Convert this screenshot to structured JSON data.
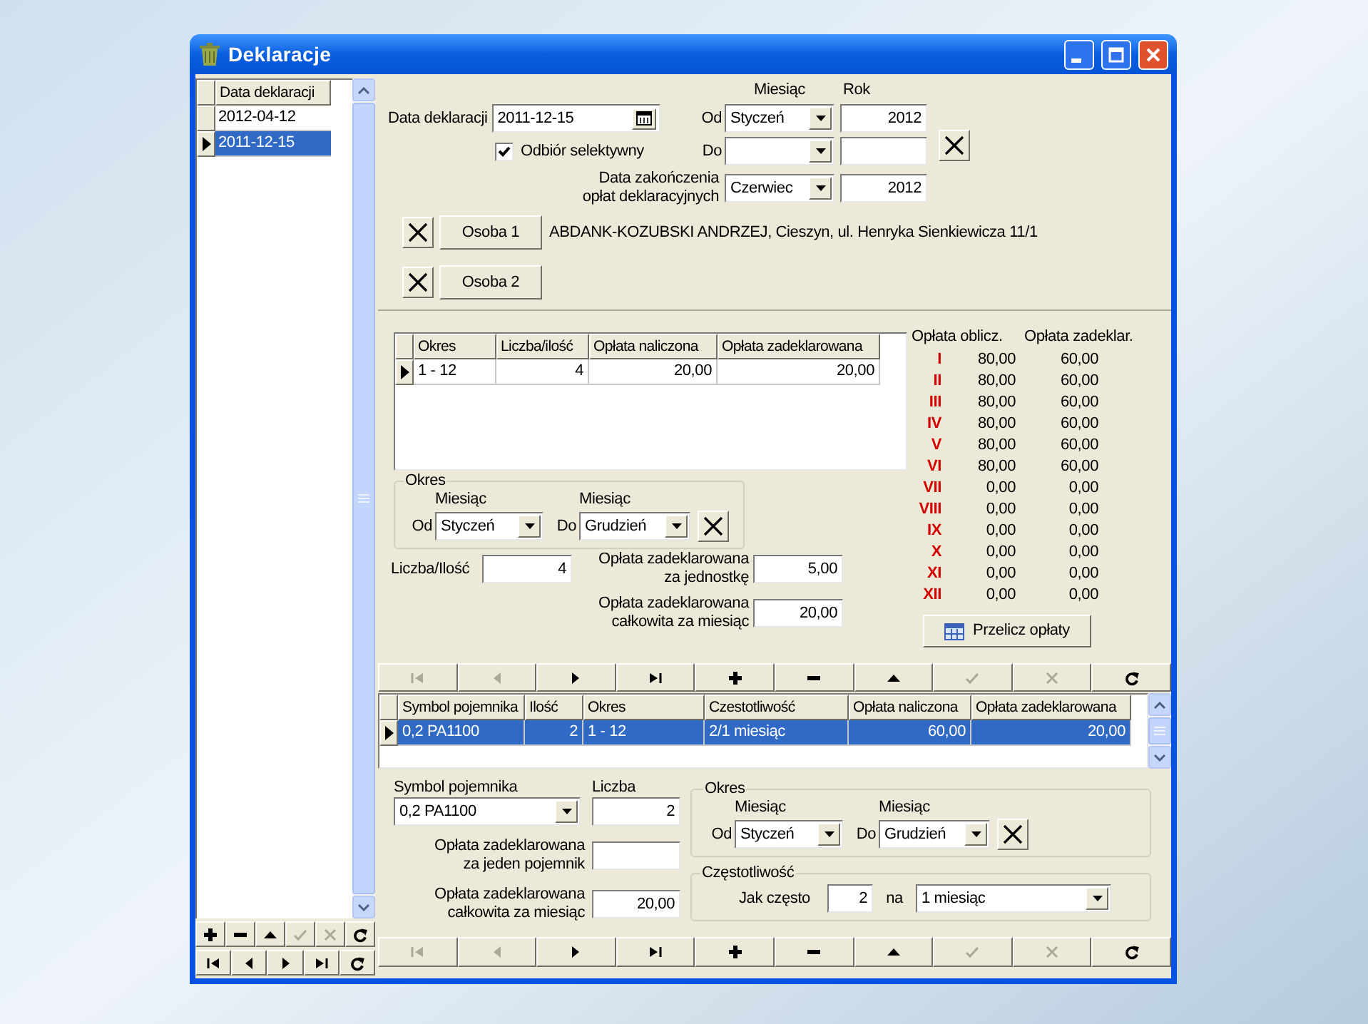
{
  "window": {
    "title": "Deklaracje"
  },
  "declarations": {
    "column": "Data deklaracji",
    "rows": [
      {
        "date": "2012-04-12",
        "current": false,
        "selected": false
      },
      {
        "date": "2011-12-15",
        "current": true,
        "selected": true
      }
    ]
  },
  "list_toolbar": {
    "rows": [
      [
        {
          "kind": "add",
          "disabled": false
        },
        {
          "kind": "remove",
          "disabled": false
        },
        {
          "kind": "up",
          "disabled": false
        },
        {
          "kind": "confirm",
          "disabled": true
        },
        {
          "kind": "cancel",
          "disabled": true
        },
        {
          "kind": "refresh",
          "disabled": false
        }
      ],
      [
        {
          "kind": "first",
          "disabled": false
        },
        {
          "kind": "prev",
          "disabled": false
        },
        {
          "kind": "next",
          "disabled": false
        },
        {
          "kind": "last",
          "disabled": false
        },
        {
          "kind": "refresh",
          "disabled": false
        }
      ]
    ]
  },
  "declaration": {
    "date_label": "Data deklaracji",
    "date": "2011-12-15",
    "month_header": "Miesiąc",
    "year_header": "Rok",
    "from_label": "Od",
    "from_month": "Styczeń",
    "from_year": "2012",
    "selective": {
      "label": "Odbiór selektywny",
      "checked": true
    },
    "to_label": "Do",
    "end_label": "Data zakończenia\nopłat deklaracyjnych",
    "end_month": "Czerwiec",
    "end_year": "2012"
  },
  "persons": [
    {
      "button": "Osoba 1",
      "details": "ABDANK-KOZUBSKI ANDRZEJ, Cieszyn, ul. Henryka Sienkiewicza 11/1"
    },
    {
      "button": "Osoba 2"
    }
  ],
  "periods_table": {
    "columns": [
      "Okres",
      "Liczba/ilość",
      "Opłata naliczona",
      "Opłata zadeklarowana"
    ],
    "rows": [
      {
        "cells": [
          "1 - 12",
          "4",
          "20,00",
          "20,00"
        ],
        "current": true,
        "selected": false
      }
    ]
  },
  "period": {
    "title": "Okres",
    "from_header": "Miesiąc",
    "from_label": "Od",
    "from": "Styczeń",
    "to_header": "Miesiąc",
    "to_label": "Do",
    "to": "Grudzień"
  },
  "quantity": {
    "label": "Liczba/Ilość",
    "value": "4"
  },
  "unit_fee": {
    "label": "Opłata zadeklarowana\nza jednostkę",
    "value": "5,00"
  },
  "monthly_fee": {
    "label": "Opłata zadeklarowana\ncałkowita za miesiąc",
    "value": "20,00"
  },
  "summary": {
    "columns": [
      "Opłata oblicz.",
      "Opłata zadeklar."
    ],
    "rows": [
      {
        "month": "I",
        "calculated": "80,00",
        "declared": "60,00"
      },
      {
        "month": "II",
        "calculated": "80,00",
        "declared": "60,00"
      },
      {
        "month": "III",
        "calculated": "80,00",
        "declared": "60,00"
      },
      {
        "month": "IV",
        "calculated": "80,00",
        "declared": "60,00"
      },
      {
        "month": "V",
        "calculated": "80,00",
        "declared": "60,00"
      },
      {
        "month": "VI",
        "calculated": "80,00",
        "declared": "60,00"
      },
      {
        "month": "VII",
        "calculated": "0,00",
        "declared": "0,00"
      },
      {
        "month": "VIII",
        "calculated": "0,00",
        "declared": "0,00"
      },
      {
        "month": "IX",
        "calculated": "0,00",
        "declared": "0,00"
      },
      {
        "month": "X",
        "calculated": "0,00",
        "declared": "0,00"
      },
      {
        "month": "XI",
        "calculated": "0,00",
        "declared": "0,00"
      },
      {
        "month": "XII",
        "calculated": "0,00",
        "declared": "0,00"
      }
    ]
  },
  "recalculate_button": "Przelicz opłaty",
  "periods_toolbar": [
    {
      "kind": "first",
      "disabled": true
    },
    {
      "kind": "prev",
      "disabled": true
    },
    {
      "kind": "next",
      "disabled": false
    },
    {
      "kind": "last",
      "disabled": false
    },
    {
      "kind": "add",
      "disabled": false
    },
    {
      "kind": "remove",
      "disabled": false
    },
    {
      "kind": "up",
      "disabled": false
    },
    {
      "kind": "confirm",
      "disabled": true
    },
    {
      "kind": "cancel",
      "disabled": true
    },
    {
      "kind": "refresh",
      "disabled": false
    }
  ],
  "containers_table": {
    "columns": [
      "Symbol pojemnika",
      "Ilość",
      "Okres",
      "Czestotliwość",
      "Opłata naliczona",
      "Opłata zadeklarowana"
    ],
    "rows": [
      {
        "cells": [
          "0,2 PA1100",
          "2",
          "1 - 12",
          "2/1 miesiąc",
          "60,00",
          "20,00"
        ],
        "current": true,
        "selected": true
      }
    ]
  },
  "container": {
    "symbol_label": "Symbol pojemnika",
    "symbol": "0,2 PA1100",
    "count_label": "Liczba",
    "count": "2",
    "unit_fee_label": "Opłata zadeklarowana\nza jeden pojemnik",
    "total_fee_label": "Opłata zadeklarowana\ncałkowita za miesiąc",
    "total_fee": "20,00",
    "period": {
      "title": "Okres",
      "from_header": "Miesiąc",
      "from_label": "Od",
      "from": "Styczeń",
      "to_header": "Miesiąc",
      "to_label": "Do",
      "to": "Grudzień"
    },
    "frequency": {
      "title": "Częstotliwość",
      "label": "Jak często",
      "value": "2",
      "per_label": "na",
      "unit": "1 miesiąc"
    }
  },
  "containers_toolbar": [
    {
      "kind": "first",
      "disabled": true
    },
    {
      "kind": "prev",
      "disabled": true
    },
    {
      "kind": "next",
      "disabled": false
    },
    {
      "kind": "last",
      "disabled": false
    },
    {
      "kind": "add",
      "disabled": false
    },
    {
      "kind": "remove",
      "disabled": false
    },
    {
      "kind": "up",
      "disabled": false
    },
    {
      "kind": "confirm",
      "disabled": true
    },
    {
      "kind": "cancel",
      "disabled": true
    },
    {
      "kind": "refresh",
      "disabled": false
    }
  ]
}
